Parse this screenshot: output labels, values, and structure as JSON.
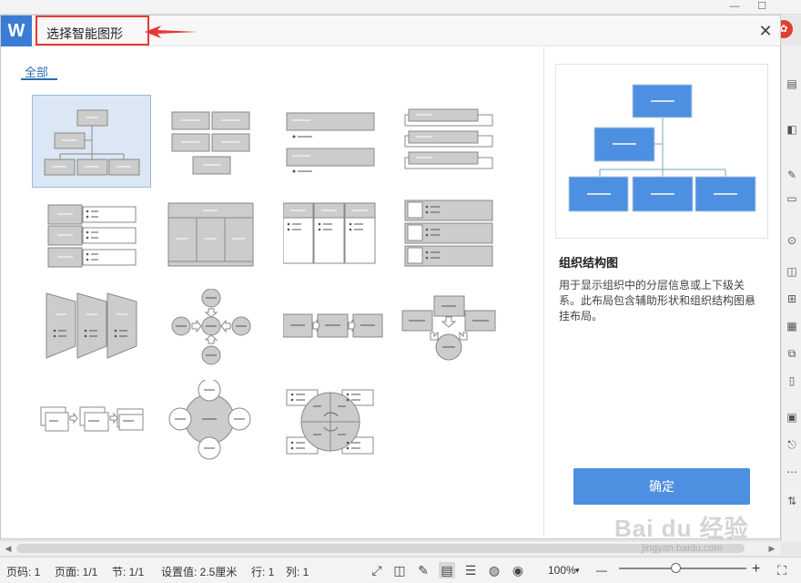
{
  "dialog": {
    "logo": "W",
    "title": "选择智能图形",
    "close": "✕",
    "tab_all": "全部",
    "ok_label": "确定"
  },
  "panel": {
    "title": "组织结构图",
    "description": "用于显示组织中的分层信息或上下级关系。此布局包含辅助形状和组织结构图悬挂布局。"
  },
  "window": {
    "minimize": "—",
    "maximize": "☐",
    "avatar": "✿"
  },
  "statusbar": {
    "page": "页码: 1",
    "pages": "页面: 1/1",
    "section": "节: 1/1",
    "setting": "设置值: 2.5厘米",
    "row": "行: 1",
    "col": "列: 1",
    "zoom": "100%",
    "zoom_minus": "—",
    "zoom_plus": "+",
    "zoom_fraction": 0.45
  },
  "watermark": {
    "brand": "Bai du 经验",
    "url": "jingyan.baidu.com"
  },
  "colors": {
    "accent": "#4d8fe0",
    "logo": "#3a7bd5",
    "annotation": "#e53935",
    "thumb_shape": "#cccccc"
  }
}
